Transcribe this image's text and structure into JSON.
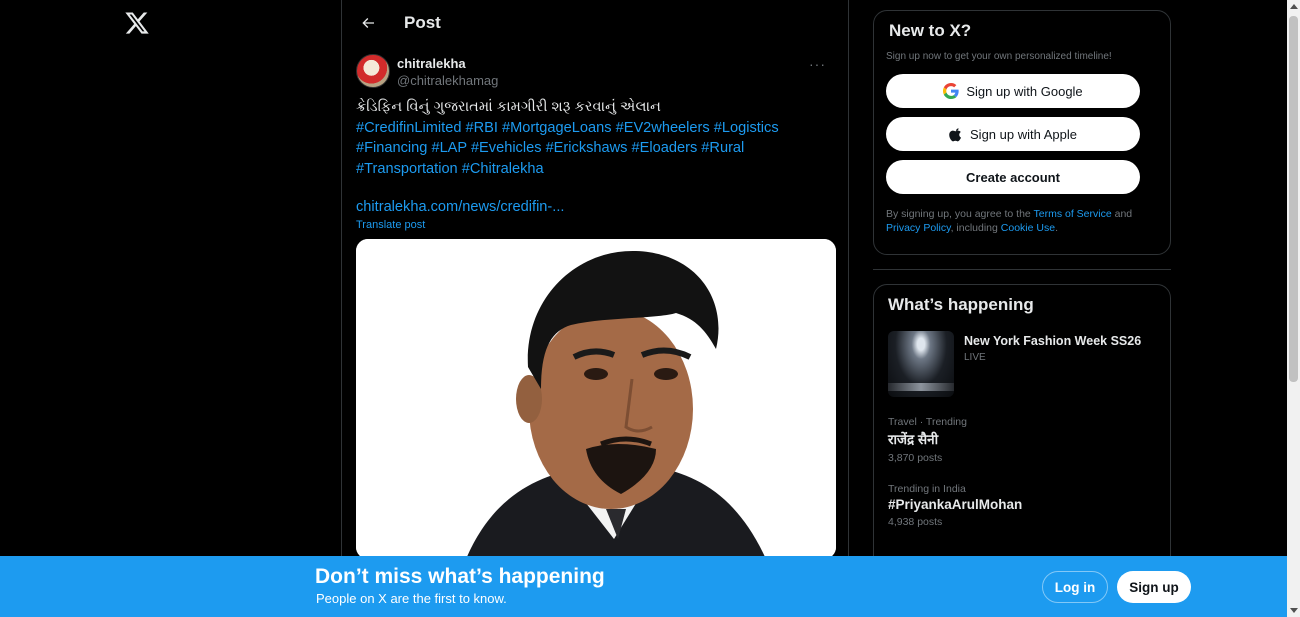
{
  "header": {
    "title": "Post"
  },
  "post": {
    "display_name": "chitralekha",
    "handle": "@chitralekhamag",
    "more": "···",
    "headline": "ક્રેડિફિન વિનું ગુજરાતમાં કામગીરી શરૂ કરવાનું એલાન",
    "hashtags_line1": "#CredifinLimited #RBI #MortgageLoans #EV2wheelers #Logistics",
    "hashtags_line2": "#Financing #LAP #Evehicles #Erickshaws #Eloaders  #Rural",
    "hashtags_line3": "#Transportation  #Chitralekha",
    "link": "chitralekha.com/news/credifin-...",
    "translate": "Translate post"
  },
  "signup_card": {
    "title": "New to X?",
    "subtitle": "Sign up now to get your own personalized timeline!",
    "google_label": "Sign up with Google",
    "apple_label": "Sign up with Apple",
    "create_label": "Create account",
    "terms_prefix": "By signing up, you agree to the ",
    "terms_link": "Terms of Service",
    "terms_and": " and ",
    "privacy_link": "Privacy Policy",
    "terms_mid": ", including ",
    "cookie_link": "Cookie Use",
    "terms_end": "."
  },
  "trending": {
    "title": "What’s happening",
    "event": {
      "title": "New York Fashion Week SS26",
      "status": "LIVE"
    },
    "items": [
      {
        "meta": "Travel · Trending",
        "name": "राजेंद्र सैनी",
        "count": "3,870 posts"
      },
      {
        "meta": "Trending in India",
        "name": "#PriyankaArulMohan",
        "count": "4,938 posts"
      }
    ]
  },
  "banner": {
    "title": "Don’t miss what’s happening",
    "subtitle": "People on X are the first to know.",
    "login_label": "Log in",
    "signup_label": "Sign up"
  },
  "colors": {
    "accent": "#1d9bf0",
    "background": "#000000",
    "border": "#2f3336",
    "muted": "#71767b"
  },
  "icons": [
    "x-logo-icon",
    "back-arrow-icon",
    "more-icon",
    "google-icon",
    "apple-icon"
  ]
}
